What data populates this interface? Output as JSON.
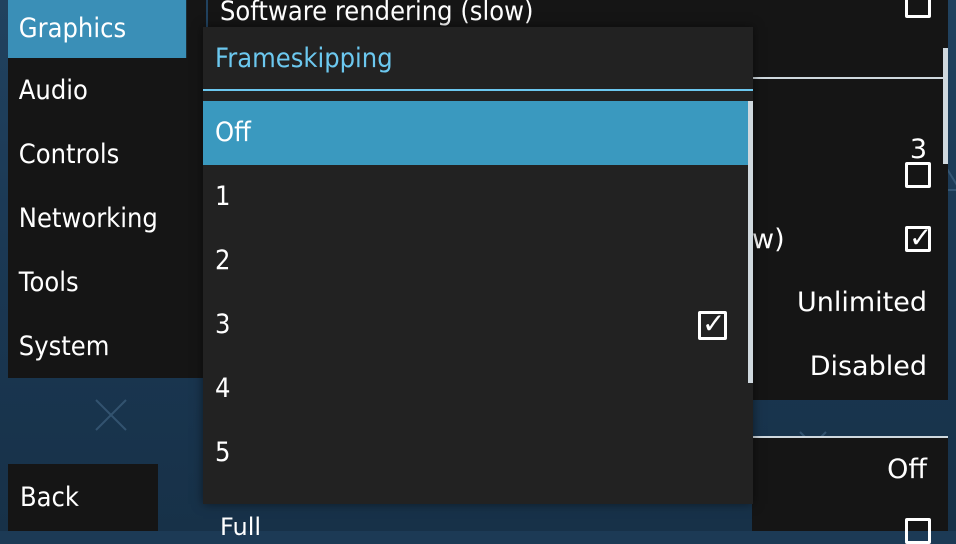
{
  "sidebar": {
    "items": [
      {
        "label": "Graphics",
        "selected": true
      },
      {
        "label": "Audio"
      },
      {
        "label": "Controls"
      },
      {
        "label": "Networking"
      },
      {
        "label": "Tools"
      },
      {
        "label": "System"
      }
    ],
    "back_label": "Back"
  },
  "settings": {
    "top_label": "Software rendering (slow)",
    "frameskip_value": "3",
    "partial_label_tail": "w)",
    "fps_limit_value": "Unlimited",
    "disabled_value": "Disabled",
    "off_value": "Off",
    "bottom_partial": "Full"
  },
  "popup": {
    "title": "Frameskipping",
    "options": [
      {
        "label": "Off",
        "highlighted": true
      },
      {
        "label": "1"
      },
      {
        "label": "2"
      },
      {
        "label": "3",
        "checked": true
      },
      {
        "label": "4"
      },
      {
        "label": "5"
      }
    ]
  },
  "colors": {
    "accent": "#3a99bf",
    "title": "#6cc8ef",
    "panel": "#151515",
    "popup": "#222222",
    "background": "#1c3a55"
  },
  "icons": {
    "checkmark": "✓",
    "background_symbols": [
      "circle-icon",
      "cross-icon",
      "square-icon",
      "triangle-icon"
    ]
  }
}
